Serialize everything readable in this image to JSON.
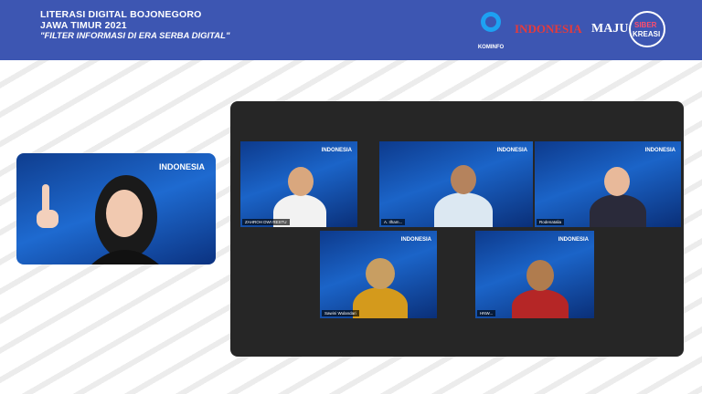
{
  "header": {
    "line1": "LITERASI DIGITAL BOJONEGORO",
    "line2": "JAWA TIMUR 2021",
    "tagline": "\"FILTER INFORMASI DI ERA SERBA DIGITAL\"",
    "kominfo": "KOMINFO",
    "indonesia": "INDONESIA",
    "maju": "MAJU",
    "siber": "SIBER",
    "kreasi": "KREASI",
    "bg_color": "#3d56b2"
  },
  "host": {
    "brand": "INDONESIA"
  },
  "participants": [
    {
      "name": "ZAHROH DWI RESTU"
    },
    {
      "name": "A. Ilham..."
    },
    {
      "name": "Rodenatalia"
    },
    {
      "name": "Sawini Wulandari"
    },
    {
      "name": "HNW..."
    }
  ],
  "tile_brand": "INDONESIA"
}
